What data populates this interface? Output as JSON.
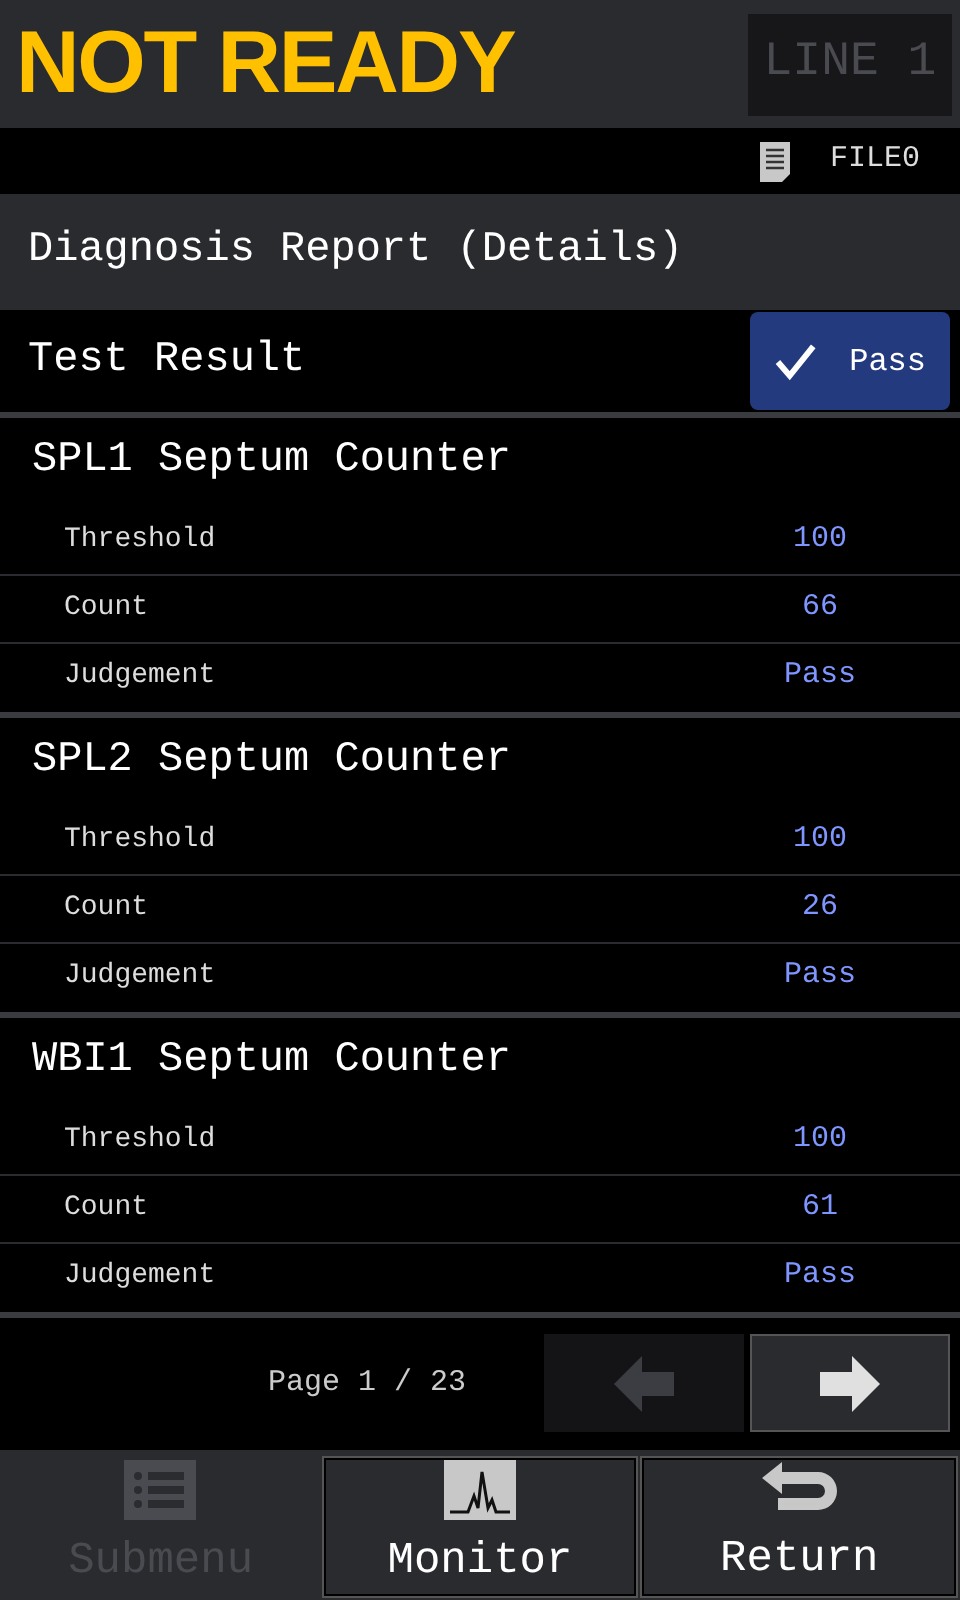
{
  "status": "NOT READY",
  "line_button": {
    "label": "LINE 1",
    "disabled": true
  },
  "file": {
    "name": "FILE0"
  },
  "title": "Diagnosis Report (Details)",
  "test_result": {
    "label": "Test Result",
    "value": "Pass",
    "checked": true
  },
  "sections": [
    {
      "heading": "SPL1 Septum Counter",
      "rows": [
        {
          "label": "Threshold",
          "value": "100"
        },
        {
          "label": "Count",
          "value": "66"
        },
        {
          "label": "Judgement",
          "value": "Pass"
        }
      ]
    },
    {
      "heading": "SPL2 Septum Counter",
      "rows": [
        {
          "label": "Threshold",
          "value": "100"
        },
        {
          "label": "Count",
          "value": "26"
        },
        {
          "label": "Judgement",
          "value": "Pass"
        }
      ]
    },
    {
      "heading": "WBI1 Septum Counter",
      "rows": [
        {
          "label": "Threshold",
          "value": "100"
        },
        {
          "label": "Count",
          "value": "61"
        },
        {
          "label": "Judgement",
          "value": "Pass"
        }
      ]
    }
  ],
  "pager": {
    "text": "Page 1 / 23",
    "prev_disabled": true,
    "next_disabled": false
  },
  "bottom_buttons": [
    {
      "kind": "submenu",
      "label": "Submenu",
      "disabled": true
    },
    {
      "kind": "monitor",
      "label": "Monitor",
      "disabled": false
    },
    {
      "kind": "return",
      "label": "Return",
      "disabled": false
    }
  ]
}
